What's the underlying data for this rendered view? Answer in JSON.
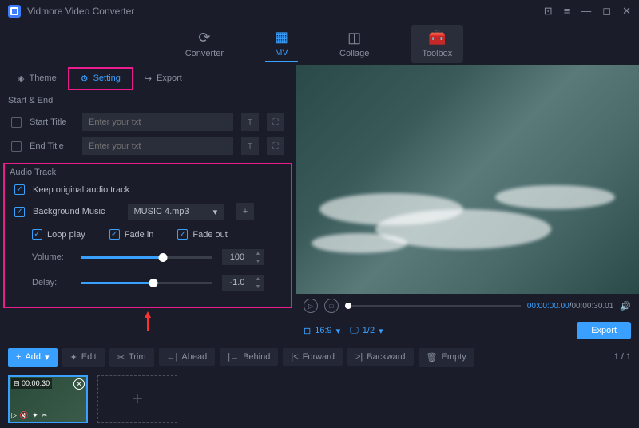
{
  "app": {
    "title": "Vidmore Video Converter"
  },
  "mainTabs": {
    "converter": "Converter",
    "mv": "MV",
    "collage": "Collage",
    "toolbox": "Toolbox"
  },
  "subTabs": {
    "theme": "Theme",
    "setting": "Setting",
    "export": "Export"
  },
  "startEnd": {
    "heading": "Start & End",
    "startTitle": "Start Title",
    "endTitle": "End Title",
    "placeholder": "Enter your txt"
  },
  "audio": {
    "heading": "Audio Track",
    "keepOriginal": "Keep original audio track",
    "bgMusic": "Background Music",
    "musicFile": "MUSIC 4.mp3",
    "loopPlay": "Loop play",
    "fadeIn": "Fade in",
    "fadeOut": "Fade out",
    "volumeLabel": "Volume:",
    "volumeValue": "100",
    "delayLabel": "Delay:",
    "delayValue": "-1.0"
  },
  "preview": {
    "currentTime": "00:00:00.00",
    "totalTime": "00:00:30.01",
    "aspect": "16:9",
    "fraction": "1/2",
    "exportBtn": "Export"
  },
  "toolbar": {
    "add": "Add",
    "edit": "Edit",
    "trim": "Trim",
    "ahead": "Ahead",
    "behind": "Behind",
    "forward": "Forward",
    "backward": "Backward",
    "empty": "Empty",
    "pageInfo": "1 / 1"
  },
  "thumb": {
    "duration": "00:00:30"
  }
}
